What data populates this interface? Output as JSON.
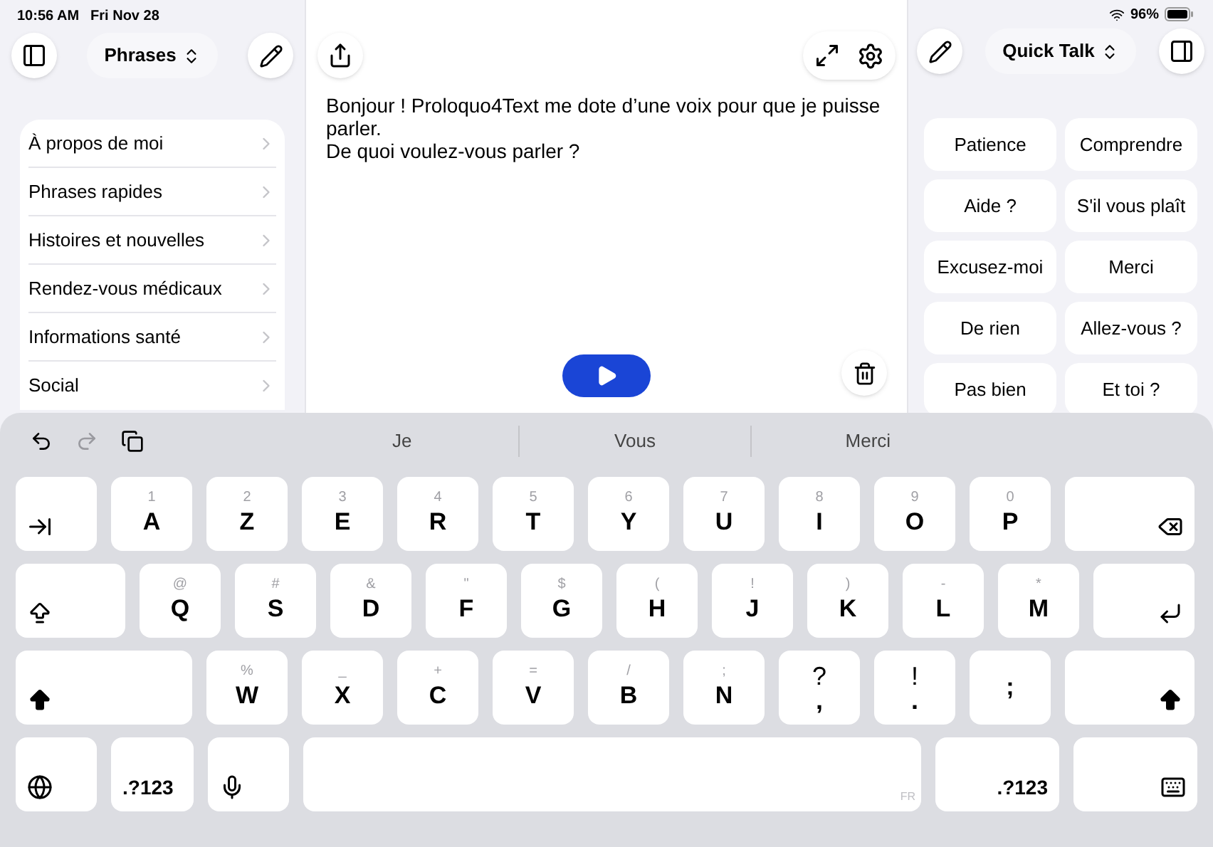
{
  "status_bar": {
    "time": "10:56 AM",
    "date": "Fri Nov 28",
    "battery": "96%"
  },
  "sidebar": {
    "title": "Phrases",
    "items": [
      {
        "label": "À propos de moi"
      },
      {
        "label": "Phrases rapides"
      },
      {
        "label": "Histoires et nouvelles"
      },
      {
        "label": "Rendez-vous médicaux"
      },
      {
        "label": "Informations santé"
      },
      {
        "label": "Social"
      }
    ]
  },
  "editor": {
    "paragraphs": [
      "Bonjour ! Proloquo4Text me dote d’une voix pour que je puisse parler.",
      "De quoi voulez-vous parler ?"
    ]
  },
  "quick_talk": {
    "title": "Quick Talk",
    "items": [
      {
        "label": "Patience"
      },
      {
        "label": "Comprendre"
      },
      {
        "label": "Aide ?"
      },
      {
        "label": "S'il vous plaît"
      },
      {
        "label": "Excusez-moi"
      },
      {
        "label": "Merci"
      },
      {
        "label": "De rien"
      },
      {
        "label": "Allez-vous ?"
      },
      {
        "label": "Pas bien"
      },
      {
        "label": "Et toi ?"
      }
    ]
  },
  "keyboard": {
    "tools": [
      {
        "kind": "undo",
        "disabled": false
      },
      {
        "kind": "redo",
        "disabled": true
      },
      {
        "kind": "paste",
        "disabled": false
      }
    ],
    "suggestions": [
      "Je",
      "Vous",
      "Merci"
    ],
    "key_rows": [
      {
        "keys": [
          {
            "kind": "tab"
          },
          {
            "kind": "letter",
            "label": "A",
            "secondary": "1"
          },
          {
            "kind": "letter",
            "label": "Z",
            "secondary": "2"
          },
          {
            "kind": "letter",
            "label": "E",
            "secondary": "3"
          },
          {
            "kind": "letter",
            "label": "R",
            "secondary": "4"
          },
          {
            "kind": "letter",
            "label": "T",
            "secondary": "5"
          },
          {
            "kind": "letter",
            "label": "Y",
            "secondary": "6"
          },
          {
            "kind": "letter",
            "label": "U",
            "secondary": "7"
          },
          {
            "kind": "letter",
            "label": "I",
            "secondary": "8"
          },
          {
            "kind": "letter",
            "label": "O",
            "secondary": "9"
          },
          {
            "kind": "letter",
            "label": "P",
            "secondary": "0"
          },
          {
            "kind": "backspace"
          }
        ]
      },
      {
        "keys": [
          {
            "kind": "capslock"
          },
          {
            "kind": "letter",
            "label": "Q",
            "secondary": "@"
          },
          {
            "kind": "letter",
            "label": "S",
            "secondary": "#"
          },
          {
            "kind": "letter",
            "label": "D",
            "secondary": "&"
          },
          {
            "kind": "letter",
            "label": "F",
            "secondary": "\""
          },
          {
            "kind": "letter",
            "label": "G",
            "secondary": "$"
          },
          {
            "kind": "letter",
            "label": "H",
            "secondary": "("
          },
          {
            "kind": "letter",
            "label": "J",
            "secondary": "!"
          },
          {
            "kind": "letter",
            "label": "K",
            "secondary": ")"
          },
          {
            "kind": "letter",
            "label": "L",
            "secondary": "-"
          },
          {
            "kind": "letter",
            "label": "M",
            "secondary": "*"
          },
          {
            "kind": "return"
          }
        ]
      },
      {
        "keys": [
          {
            "kind": "shift"
          },
          {
            "kind": "letter",
            "label": "W",
            "secondary": "%"
          },
          {
            "kind": "letter",
            "label": "X",
            "secondary": "_"
          },
          {
            "kind": "letter",
            "label": "C",
            "secondary": "+"
          },
          {
            "kind": "letter",
            "label": "V",
            "secondary": "="
          },
          {
            "kind": "letter",
            "label": "B",
            "secondary": "/"
          },
          {
            "kind": "letter",
            "label": "N",
            "secondary": ";"
          },
          {
            "kind": "punct",
            "label": ",",
            "secondary": "?"
          },
          {
            "kind": "punct",
            "label": ".",
            "secondary": "!"
          },
          {
            "kind": "letter",
            "label": ";"
          },
          {
            "kind": "shift"
          }
        ]
      },
      {
        "keys": [
          {
            "kind": "globe"
          },
          {
            "kind": "numbers",
            "label": ".?123"
          },
          {
            "kind": "mic"
          },
          {
            "kind": "space",
            "label": "FR"
          },
          {
            "kind": "numbers",
            "label": ".?123"
          },
          {
            "kind": "hide"
          }
        ]
      }
    ]
  }
}
